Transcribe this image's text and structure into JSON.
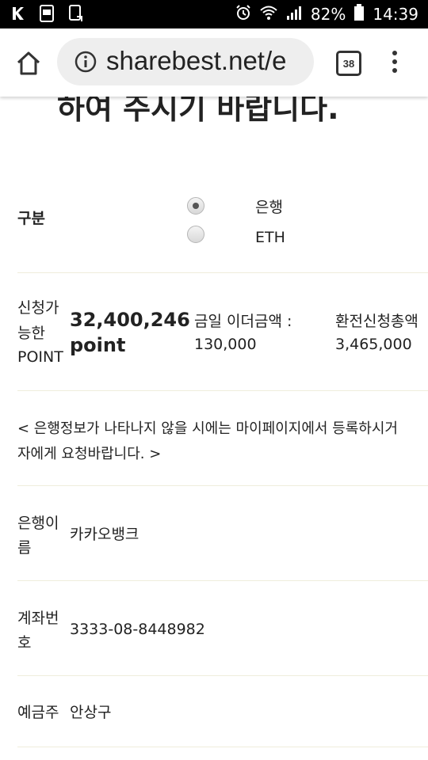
{
  "status_bar": {
    "battery": "82%",
    "time": "14:39",
    "left_icons": [
      "k-notification-icon",
      "app-notification-icon",
      "screenshot-icon"
    ],
    "right_icons": [
      "alarm-icon",
      "wifi-icon",
      "signal-icon",
      "battery-icon"
    ]
  },
  "browser": {
    "url": "sharebest.net/e",
    "tab_count": "38"
  },
  "page": {
    "heading": "하여 주시기 바랍니다.",
    "type_label": "구분",
    "options": [
      {
        "label": "은행",
        "selected": true
      },
      {
        "label": "ETH",
        "selected": false
      }
    ],
    "point_label": "신청가능한POINT",
    "point_label_lines": [
      "신청가",
      "능한",
      "POINT"
    ],
    "point_value": "32,400,246",
    "point_unit": "point",
    "eth_today_label": "금일 이더금액 :",
    "eth_today_value": "130,000",
    "exchange_total_label": "환전신청총액",
    "exchange_total_value": "3,465,000",
    "notice_line1": "< 은행정보가 나타나지 않을 시에는 마이페이지에서 등록하시거",
    "notice_line2": "자에게 요청바랍니다. >",
    "bank_label_lines": [
      "은행이",
      "름"
    ],
    "bank_value": "카카오뱅크",
    "account_label_lines": [
      "계좌번",
      "호"
    ],
    "account_value": "3333-08-8448982",
    "holder_label": "예금주",
    "holder_value": "안상구"
  }
}
